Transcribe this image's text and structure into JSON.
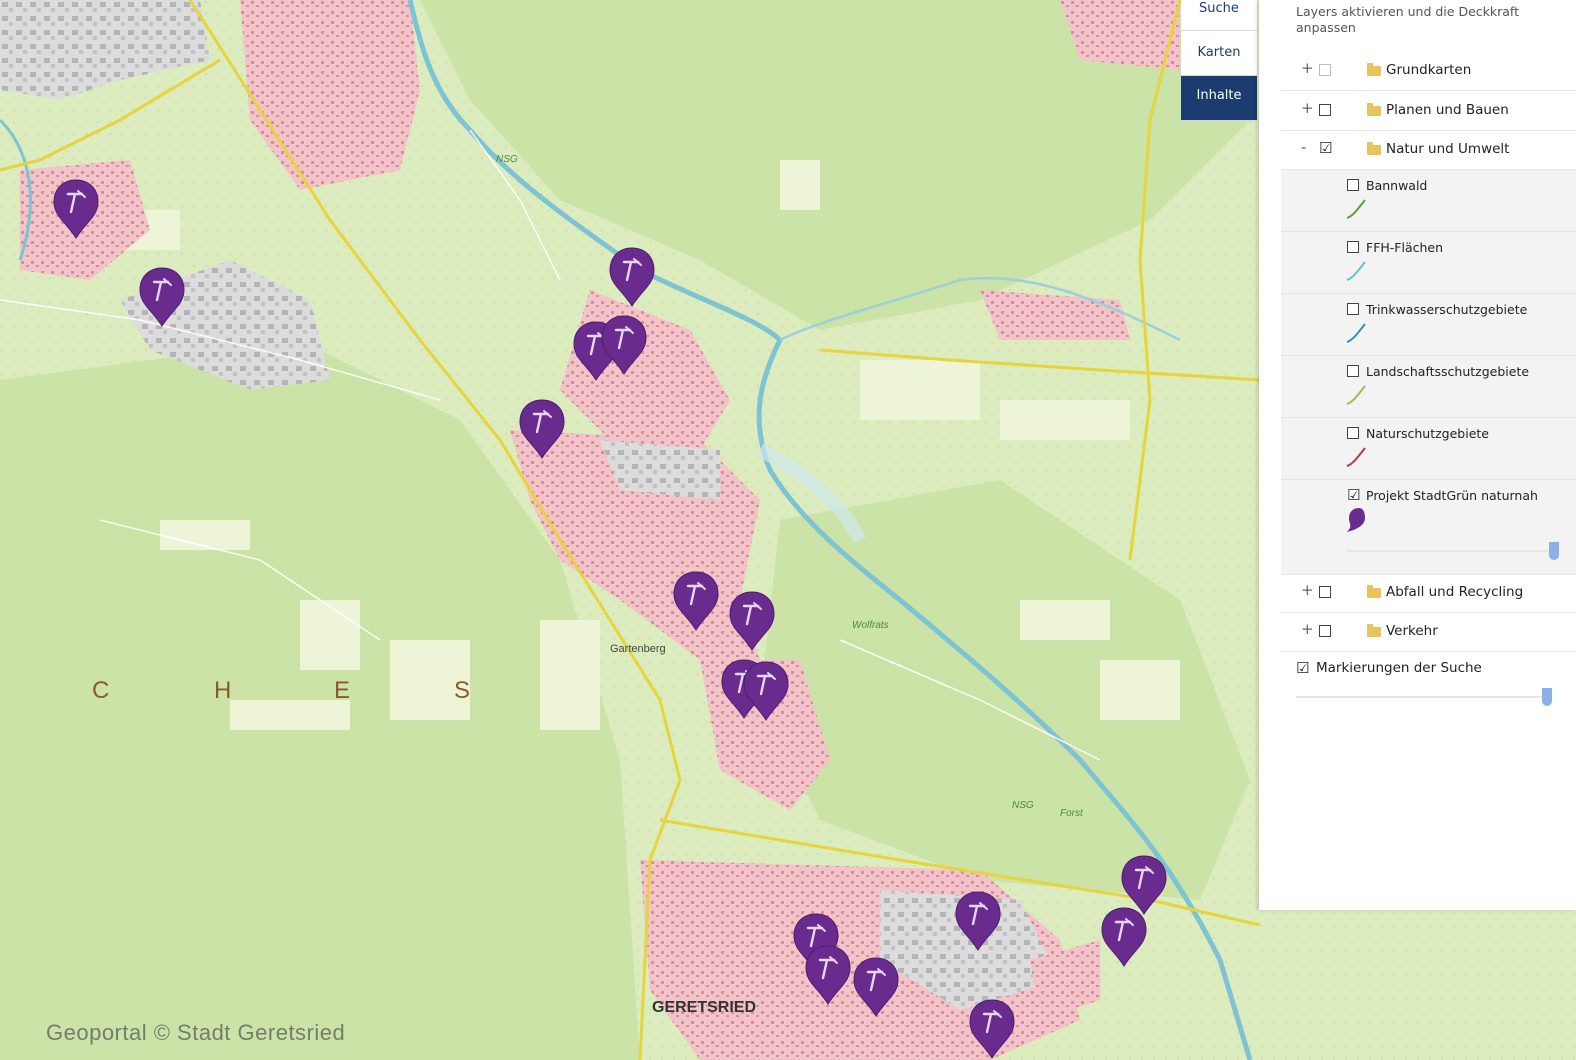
{
  "map": {
    "attribution": "Geoportal © Stadt Geretsried",
    "labels": {
      "town": "GERETSRIED",
      "district": "Gartenberg",
      "forest_letters": [
        "C",
        "H",
        "E",
        "S"
      ],
      "nsg_1": "NSG",
      "nsg_2": "NSG",
      "forest_name": "Forst",
      "wolfrats": "Wolfrats"
    },
    "marker_icon": "hammer-pin-icon",
    "marker_color": "#6a2b8f",
    "road_color": "#e7d33c",
    "river_color": "#7ec3d4"
  },
  "tabs": [
    {
      "label": "Suche",
      "active": false
    },
    {
      "label": "Karten",
      "active": false
    },
    {
      "label": "Inhalte",
      "active": true
    }
  ],
  "panel": {
    "hint": "Layers aktivieren und die Deckkraft anpassen",
    "groups": {
      "grundkarten": {
        "toggle": "+",
        "label": "Grundkarten",
        "checked": false
      },
      "planen": {
        "toggle": "+",
        "label": "Planen und Bauen",
        "checked": false
      },
      "natur": {
        "toggle": "-",
        "label": "Natur und Umwelt",
        "checked": true
      },
      "abfall": {
        "toggle": "+",
        "label": "Abfall und Recycling",
        "checked": false
      },
      "verkehr": {
        "toggle": "+",
        "label": "Verkehr",
        "checked": false
      }
    },
    "natur_layers": [
      {
        "label": "Bannwald",
        "checked": false,
        "color": "#5aa13a"
      },
      {
        "label": "FFH-Flächen",
        "checked": false,
        "color": "#5fc2c8"
      },
      {
        "label": "Trinkwasserschutzgebiete",
        "checked": false,
        "color": "#3b8ec2"
      },
      {
        "label": "Landschaftsschutzgebiete",
        "checked": false,
        "color": "#9ac04a"
      },
      {
        "label": "Naturschutzgebiete",
        "checked": false,
        "color": "#c8334a"
      },
      {
        "label": "Projekt StadtGrün naturnah",
        "checked": true,
        "color": "#6a2b8f"
      }
    ],
    "search_markers": {
      "label": "Markierungen der Suche",
      "checked": true
    },
    "check_mark": "☑",
    "opacity_stadtgruen": 1.0,
    "opacity_search": 1.0
  }
}
